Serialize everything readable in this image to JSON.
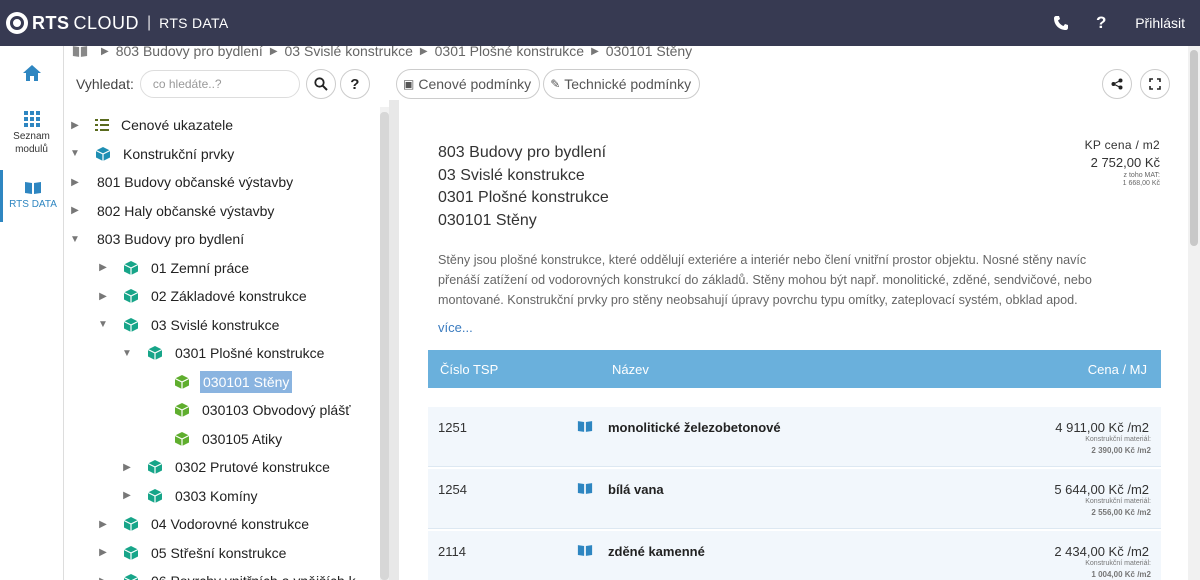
{
  "header": {
    "brand_rts": "RTS",
    "brand_cloud": "CLOUD",
    "brand_sep": "|",
    "brand_data": "RTS DATA",
    "phone_icon": "☎",
    "help_icon": "?",
    "login": "Přihlásit"
  },
  "rail": {
    "home_icon": "home-icon",
    "moduly_label_1": "Seznam",
    "moduly_label_2": "modulů",
    "rtsdata_label": "RTS DATA"
  },
  "breadcrumb": {
    "items": [
      "803 Budovy pro bydlení",
      "03 Svislé konstrukce",
      "0301 Plošné konstrukce",
      "030101 Stěny"
    ]
  },
  "search": {
    "label": "Vyhledat:",
    "placeholder": "co hledáte..?",
    "help": "?"
  },
  "tabs": [
    {
      "label": "Cenové podmínky",
      "icon": "money-icon"
    },
    {
      "label": "Technické podmínky",
      "icon": "pencil-icon"
    }
  ],
  "tree": [
    {
      "label": "Cenové ukazatele",
      "level": 0,
      "caret": "right",
      "icon": "list"
    },
    {
      "label": "Konstrukční prvky",
      "level": 0,
      "caret": "down",
      "icon": "cube-blue"
    },
    {
      "label": "801 Budovy občanské výstavby",
      "level": 1,
      "caret": "right",
      "icon": "none"
    },
    {
      "label": "802 Haly občanské výstavby",
      "level": 1,
      "caret": "right",
      "icon": "none"
    },
    {
      "label": "803 Budovy pro bydlení",
      "level": 1,
      "caret": "down",
      "icon": "none"
    },
    {
      "label": "01 Zemní práce",
      "level": 2,
      "caret": "right",
      "icon": "cube-teal"
    },
    {
      "label": "02 Základové konstrukce",
      "level": 2,
      "caret": "right",
      "icon": "cube-teal"
    },
    {
      "label": "03 Svislé konstrukce",
      "level": 2,
      "caret": "down",
      "icon": "cube-teal"
    },
    {
      "label": "0301 Plošné konstrukce",
      "level": 3,
      "caret": "down",
      "icon": "cube-teal"
    },
    {
      "label": "030101 Stěny",
      "level": 4,
      "caret": "none",
      "icon": "cube-green",
      "selected": true
    },
    {
      "label": "030103 Obvodový plášť",
      "level": 4,
      "caret": "none",
      "icon": "cube-green"
    },
    {
      "label": "030105 Atiky",
      "level": 4,
      "caret": "none",
      "icon": "cube-green"
    },
    {
      "label": "0302 Prutové konstrukce",
      "level": 3,
      "caret": "right",
      "icon": "cube-teal"
    },
    {
      "label": "0303 Komíny",
      "level": 3,
      "caret": "right",
      "icon": "cube-teal"
    },
    {
      "label": "04 Vodorovné konstrukce",
      "level": 2,
      "caret": "right",
      "icon": "cube-teal"
    },
    {
      "label": "05 Střešní konstrukce",
      "level": 2,
      "caret": "right",
      "icon": "cube-teal"
    },
    {
      "label": "06 Povrchy vnitřních a vnějších k",
      "level": 2,
      "caret": "right",
      "icon": "cube-teal"
    }
  ],
  "detail": {
    "hierarchy": [
      "803 Budovy pro bydlení",
      "03 Svislé konstrukce",
      "0301 Plošné konstrukce",
      "030101 Stěny"
    ],
    "kp_label": "KP cena / m2",
    "kp_value": "2 752,00 Kč",
    "kp_sub_label": "z toho MAT:",
    "kp_sub_value": "1 668,00 Kč",
    "description": "Stěny jsou plošné konstrukce, které oddělují exteriére a interiér nebo člení vnitřní prostor objektu. Nosné stěny navíc přenáší zatížení od vodorovných konstrukcí do základů. Stěny mohou být např. monolitické, zděné, sendvičové, nebo montované. Konstrukční prvky pro stěny neobsahují úpravy povrchu typu omítky, zateplovací systém, obklad apod.",
    "more": "více..."
  },
  "table": {
    "headers": {
      "num": "Číslo TSP",
      "name": "Název",
      "price": "Cena / MJ"
    },
    "rows": [
      {
        "num": "1251",
        "name": "monolitické železobetonové",
        "price": "4 911,00 Kč /m2",
        "sub_label": "Konstrukční materiál:",
        "sub_value": "2 390,00 Kč /m2"
      },
      {
        "num": "1254",
        "name": "bílá vana",
        "price": "5 644,00 Kč /m2",
        "sub_label": "Konstrukční materiál:",
        "sub_value": "2 556,00 Kč /m2"
      },
      {
        "num": "2114",
        "name": "zděné kamenné",
        "price": "2 434,00 Kč /m2",
        "sub_label": "Konstrukční materiál:",
        "sub_value": "1 004,00 Kč /m2"
      }
    ]
  },
  "colors": {
    "topbar": "#373a52",
    "accent": "#2e86c1",
    "table_header": "#6ab0dc",
    "row_bg": "#f2f7fc",
    "cube_teal": "#17a589",
    "cube_green": "#5fae2e",
    "cube_blue": "#1f8fb3",
    "selected": "#8ab4e0"
  }
}
